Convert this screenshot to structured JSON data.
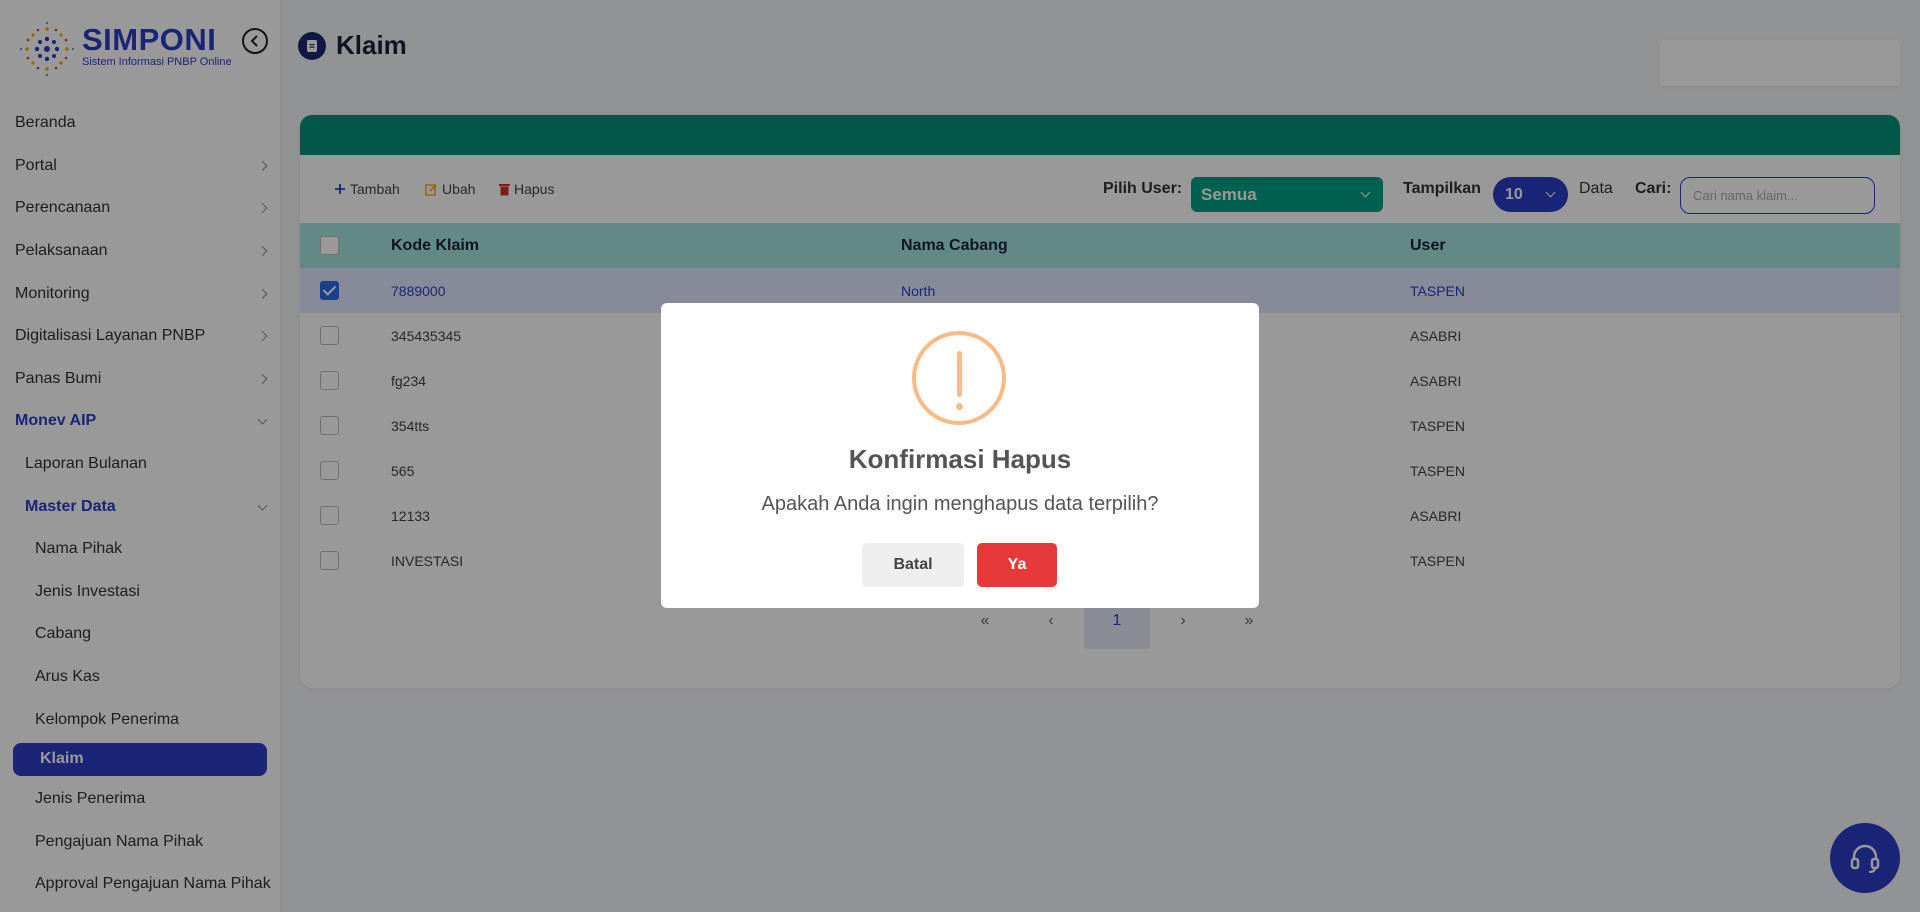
{
  "brand": {
    "name": "SIMPONI",
    "subtitle": "Sistem Informasi PNBP Online"
  },
  "sidebar": {
    "items": [
      {
        "label": "Beranda"
      },
      {
        "label": "Portal"
      },
      {
        "label": "Perencanaan"
      },
      {
        "label": "Pelaksanaan"
      },
      {
        "label": "Monitoring"
      },
      {
        "label": "Digitalisasi Layanan PNBP"
      },
      {
        "label": "Panas Bumi"
      },
      {
        "label": "Monev AIP"
      },
      {
        "label": "Laporan Bulanan"
      },
      {
        "label": "Master Data"
      },
      {
        "label": "Nama Pihak"
      },
      {
        "label": "Jenis Investasi"
      },
      {
        "label": "Cabang"
      },
      {
        "label": "Arus Kas"
      },
      {
        "label": "Kelompok Penerima"
      },
      {
        "label": "Klaim"
      },
      {
        "label": "Jenis Penerima"
      },
      {
        "label": "Pengajuan Nama Pihak"
      },
      {
        "label": "Approval Pengajuan Nama Pihak"
      }
    ]
  },
  "page": {
    "title": "Klaim"
  },
  "toolbar": {
    "add_label": "Tambah",
    "edit_label": "Ubah",
    "delete_label": "Hapus",
    "user_filter_label": "Pilih User:",
    "user_filter_value": "Semua",
    "show_label": "Tampilkan",
    "show_value": "10",
    "data_label": "Data",
    "search_label": "Cari:",
    "search_placeholder": "Cari nama klaim..."
  },
  "table": {
    "headers": [
      "Kode Klaim",
      "Nama Cabang",
      "User"
    ],
    "rows": [
      {
        "kode": "7889000",
        "cabang": "North",
        "user": "TASPEN",
        "checked": true
      },
      {
        "kode": "345435345",
        "cabang": "",
        "user": "ASABRI",
        "checked": false
      },
      {
        "kode": "fg234",
        "cabang": "",
        "user": "ASABRI",
        "checked": false
      },
      {
        "kode": "354tts",
        "cabang": "",
        "user": "TASPEN",
        "checked": false
      },
      {
        "kode": "565",
        "cabang": "",
        "user": "TASPEN",
        "checked": false
      },
      {
        "kode": "12133",
        "cabang": "",
        "user": "ASABRI",
        "checked": false
      },
      {
        "kode": "INVESTASI",
        "cabang": "",
        "user": "TASPEN",
        "checked": false
      }
    ]
  },
  "pagination": {
    "first": "«",
    "prev": "‹",
    "current": "1",
    "next": "›",
    "last": "»"
  },
  "modal": {
    "title": "Konfirmasi Hapus",
    "message": "Apakah Anda ingin menghapus data terpilih?",
    "cancel_label": "Batal",
    "confirm_label": "Ya"
  },
  "colors": {
    "primary": "#2e3ec9",
    "teal": "#00907a",
    "danger": "#e8393a",
    "warning": "#f8bb86"
  }
}
